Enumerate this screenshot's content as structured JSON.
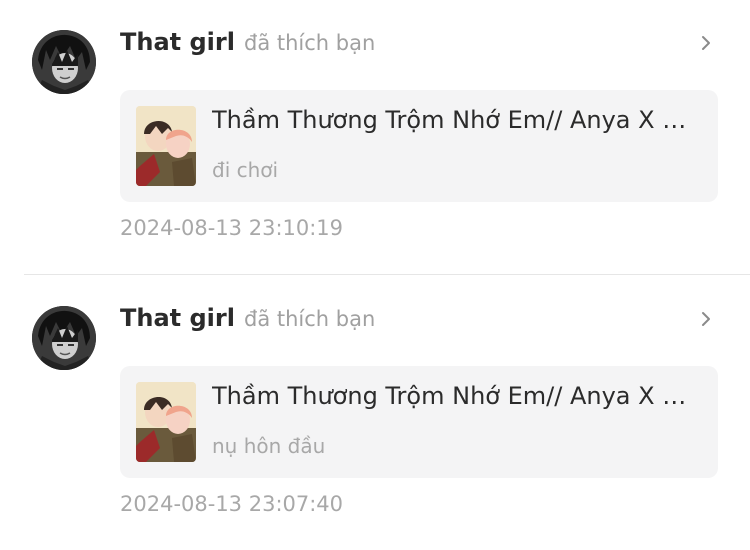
{
  "notifications": [
    {
      "user_name": "That girl",
      "action": "đã thích bạn",
      "avatar_icon": "user-avatar",
      "card": {
        "title": "Thầm Thương Trộm Nhớ Em// Anya X Damian",
        "subtitle": "đi chơi",
        "thumbnail_icon": "story-cover"
      },
      "timestamp": "2024-08-13 23:10:19"
    },
    {
      "user_name": "That girl",
      "action": "đã thích bạn",
      "avatar_icon": "user-avatar",
      "card": {
        "title": "Thầm Thương Trộm Nhớ Em// Anya X Damian",
        "subtitle": "nụ hôn đầu",
        "thumbnail_icon": "story-cover"
      },
      "timestamp": "2024-08-13 23:07:40"
    }
  ],
  "colors": {
    "name_text": "#2b2b2b",
    "secondary_text": "#a8a8a8",
    "card_background": "#f4f4f5",
    "divider": "#e6e6e6"
  }
}
